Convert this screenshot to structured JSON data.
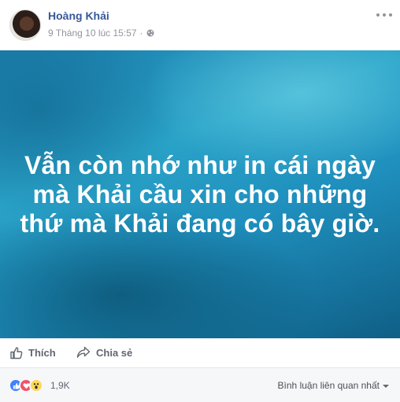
{
  "post": {
    "author": "Hoàng Khải",
    "timestamp": "9 Tháng 10 lúc 15:57",
    "privacy_icon": "globe-icon",
    "text_lines": [
      "Vẫn còn nhớ như in cái ngày",
      "mà Khải cầu xin cho những",
      "thứ mà Khải đang có bây giờ."
    ],
    "background_colors": [
      "#1b7fae",
      "#2aa3c8",
      "#0f5f86"
    ]
  },
  "actions": {
    "like_label": "Thích",
    "share_label": "Chia sẻ"
  },
  "footer": {
    "reaction_icons": [
      "like-icon",
      "love-icon",
      "wow-icon"
    ],
    "reaction_count": "1,9K",
    "sort_label": "Bình luận liên quan nhất"
  },
  "colors": {
    "author_link": "#365899",
    "meta_text": "#90949c",
    "like_reaction": "#4080ff",
    "love_reaction": "#f25268",
    "wow_reaction": "#fcd859"
  }
}
